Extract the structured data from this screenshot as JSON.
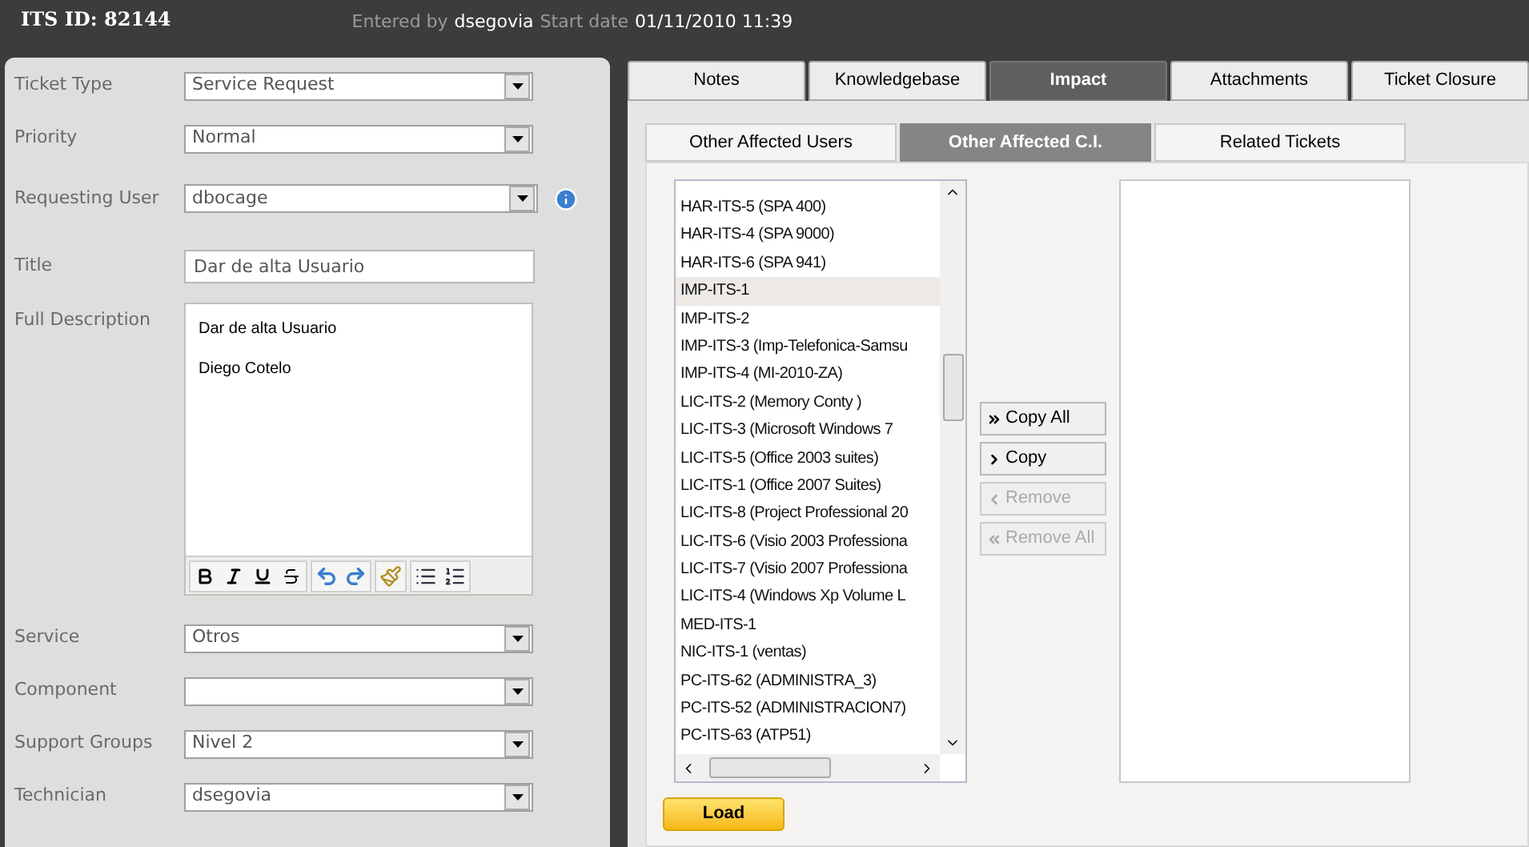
{
  "header": {
    "ticket_id": "ITS ID: 82144",
    "entered_by_label": "Entered by",
    "entered_by": "dsegovia",
    "start_date_label": "Start date",
    "start_date": "01/11/2010 11:39"
  },
  "form": {
    "fields": [
      {
        "kind": "select",
        "label": "Ticket Type",
        "value": "Service Request"
      },
      {
        "kind": "select",
        "label": "Priority",
        "value": "Normal"
      },
      {
        "kind": "select",
        "label": "Requesting User",
        "value": "dbocage",
        "info": true
      },
      {
        "kind": "text",
        "label": "Title",
        "value": "Dar de alta Usuario"
      },
      {
        "kind": "editor",
        "label": "Full Description",
        "lines": [
          "Dar de alta Usuario",
          "Diego Cotelo"
        ]
      },
      {
        "kind": "select",
        "label": "Service",
        "value": "Otros"
      },
      {
        "kind": "select",
        "label": "Component"
      },
      {
        "kind": "select",
        "label": "Support Groups",
        "value": "Nivel 2"
      },
      {
        "kind": "select",
        "label": "Technician",
        "value": "dsegovia"
      }
    ]
  },
  "tabs": [
    {
      "label": "Notes",
      "selected": false
    },
    {
      "label": "Knowledgebase",
      "selected": false
    },
    {
      "label": "Impact",
      "selected": true
    },
    {
      "label": "Attachments",
      "selected": false
    },
    {
      "label": "Ticket Closure",
      "selected": false
    }
  ],
  "subtabs": [
    {
      "label": "Other Affected Users",
      "selected": false
    },
    {
      "label": "Other Affected C.I.",
      "selected": true
    },
    {
      "label": "Related Tickets",
      "selected": false
    }
  ],
  "available_items": [
    {
      "label": "HAR-ITS-5 (SPA 400)",
      "selected": false
    },
    {
      "label": "HAR-ITS-4 (SPA 9000)",
      "selected": false
    },
    {
      "label": "HAR-ITS-6 (SPA 941)",
      "selected": false
    },
    {
      "label": "IMP-ITS-1",
      "selected": true
    },
    {
      "label": "IMP-ITS-2",
      "selected": false
    },
    {
      "label": "IMP-ITS-3 (Imp-Telefonica-Samsu",
      "selected": false
    },
    {
      "label": "IMP-ITS-4 (MI-2010-ZA)",
      "selected": false
    },
    {
      "label": "LIC-ITS-2 (Memory Conty )",
      "selected": false
    },
    {
      "label": "LIC-ITS-3 (Microsoft Windows 7",
      "selected": false
    },
    {
      "label": "LIC-ITS-5 (Office 2003 suites)",
      "selected": false
    },
    {
      "label": "LIC-ITS-1 (Office 2007 Suites)",
      "selected": false
    },
    {
      "label": "LIC-ITS-8 (Project Professional 20",
      "selected": false
    },
    {
      "label": "LIC-ITS-6 (Visio 2003 Professiona",
      "selected": false
    },
    {
      "label": "LIC-ITS-7 (Visio 2007 Professiona",
      "selected": false
    },
    {
      "label": "LIC-ITS-4 (Windows Xp Volume L",
      "selected": false
    },
    {
      "label": "MED-ITS-1",
      "selected": false
    },
    {
      "label": "NIC-ITS-1 (ventas)",
      "selected": false
    },
    {
      "label": "PC-ITS-62 (ADMINISTRA_3)",
      "selected": false
    },
    {
      "label": "PC-ITS-52 (ADMINISTRACION7)",
      "selected": false
    },
    {
      "label": "PC-ITS-63 (ATP51)",
      "selected": false
    }
  ],
  "transfer_buttons": [
    {
      "kind": "copy_all",
      "label": "Copy All",
      "disabled": false
    },
    {
      "kind": "copy",
      "label": "Copy",
      "disabled": false
    },
    {
      "kind": "remove",
      "label": "Remove",
      "disabled": true
    },
    {
      "kind": "remove_all",
      "label": "Remove All",
      "disabled": true
    }
  ],
  "load_button": "Load"
}
